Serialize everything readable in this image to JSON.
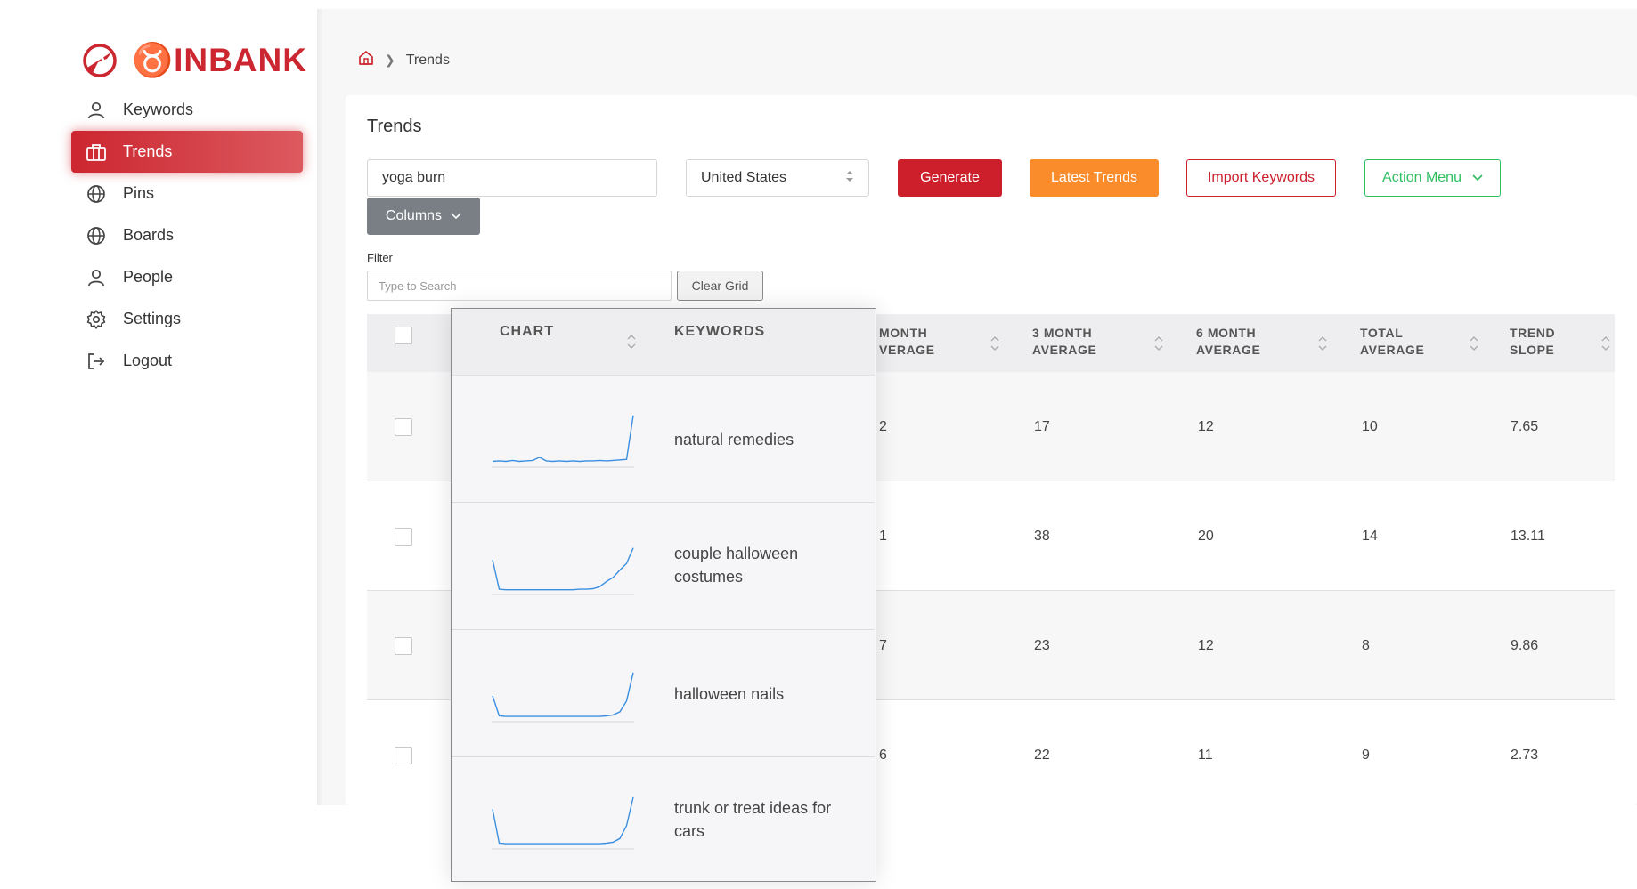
{
  "app": {
    "logo_text": "INBANK"
  },
  "sidebar": {
    "items": [
      {
        "label": "Keywords",
        "icon": "user-icon"
      },
      {
        "label": "Trends",
        "icon": "briefcase-icon",
        "active": true
      },
      {
        "label": "Pins",
        "icon": "globe-icon"
      },
      {
        "label": "Boards",
        "icon": "globe-icon"
      },
      {
        "label": "People",
        "icon": "user-icon"
      },
      {
        "label": "Settings",
        "icon": "gear-icon"
      },
      {
        "label": "Logout",
        "icon": "logout-icon"
      }
    ]
  },
  "breadcrumb": {
    "current": "Trends"
  },
  "page": {
    "title": "Trends"
  },
  "toolbar": {
    "search_value": "yoga burn",
    "country": "United States",
    "generate_label": "Generate",
    "latest_label": "Latest Trends",
    "import_label": "Import Keywords",
    "action_label": "Action Menu",
    "columns_label": "Columns"
  },
  "filter": {
    "label": "Filter",
    "placeholder": "Type to Search",
    "clear_label": "Clear Grid"
  },
  "grid": {
    "headers": {
      "month_avg_line1": "MONTH",
      "month_avg_line2": "VERAGE",
      "m3_line1": "3 MONTH",
      "m3_line2": "AVERAGE",
      "m6_line1": "6 MONTH",
      "m6_line2": "AVERAGE",
      "total_line1": "TOTAL",
      "total_line2": "AVERAGE",
      "slope_line1": "TREND",
      "slope_line2": "SLOPE"
    },
    "rows": [
      {
        "month_avg": "2",
        "m3": "17",
        "m6": "12",
        "total": "10",
        "slope": "7.65"
      },
      {
        "month_avg": "1",
        "m3": "38",
        "m6": "20",
        "total": "14",
        "slope": "13.11"
      },
      {
        "month_avg": "7",
        "m3": "23",
        "m6": "12",
        "total": "8",
        "slope": "9.86"
      },
      {
        "month_avg": "6",
        "m3": "22",
        "m6": "11",
        "total": "9",
        "slope": "2.73"
      }
    ]
  },
  "popup": {
    "chart_header": "CHART",
    "keywords_header": "KEYWORDS",
    "rows": [
      {
        "keyword": "natural remedies",
        "trend": [
          0.06,
          0.07,
          0.06,
          0.08,
          0.06,
          0.07,
          0.08,
          0.14,
          0.07,
          0.06,
          0.07,
          0.06,
          0.07,
          0.06,
          0.07,
          0.07,
          0.08,
          0.07,
          0.08,
          0.09,
          0.1,
          0.95
        ]
      },
      {
        "keyword": "couple halloween costumes",
        "trend": [
          0.62,
          0.05,
          0.04,
          0.04,
          0.04,
          0.04,
          0.04,
          0.04,
          0.04,
          0.04,
          0.04,
          0.04,
          0.04,
          0.05,
          0.05,
          0.06,
          0.1,
          0.2,
          0.28,
          0.42,
          0.55,
          0.85
        ]
      },
      {
        "keyword": "halloween nails",
        "trend": [
          0.45,
          0.06,
          0.05,
          0.05,
          0.05,
          0.05,
          0.05,
          0.05,
          0.05,
          0.05,
          0.05,
          0.05,
          0.05,
          0.05,
          0.05,
          0.05,
          0.05,
          0.06,
          0.08,
          0.14,
          0.35,
          0.9
        ]
      },
      {
        "keyword": "trunk or treat ideas for cars",
        "trend": [
          0.72,
          0.06,
          0.05,
          0.05,
          0.05,
          0.05,
          0.05,
          0.05,
          0.05,
          0.05,
          0.05,
          0.05,
          0.05,
          0.05,
          0.05,
          0.05,
          0.05,
          0.06,
          0.08,
          0.15,
          0.4,
          0.95
        ]
      }
    ]
  },
  "colors": {
    "brand_red": "#cc1f2b",
    "orange": "#fb8c2c",
    "green": "#2fbf61",
    "spark_line": "#3b8fe0"
  }
}
